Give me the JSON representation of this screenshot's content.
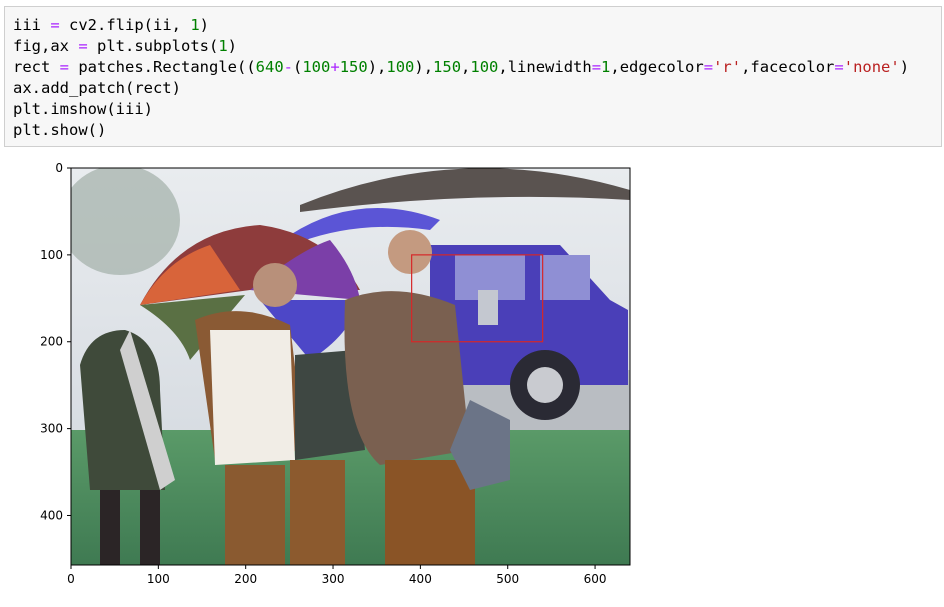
{
  "code_cell": {
    "lines": [
      "iii = cv2.flip(ii, 1)",
      "fig,ax = plt.subplots(1)",
      "rect = patches.Rectangle((640-(100+150),100),150,100,linewidth=1,edgecolor='r',facecolor='none')",
      "ax.add_patch(rect)",
      "plt.imshow(iii)",
      "plt.show()"
    ]
  },
  "plot": {
    "x_ticks": [
      "0",
      "100",
      "200",
      "300",
      "400",
      "500",
      "600"
    ],
    "y_ticks": [
      "0",
      "100",
      "200",
      "300",
      "400"
    ],
    "image_width": 640,
    "image_height": 457,
    "rectangle": {
      "x": 390,
      "y": 100,
      "width": 150,
      "height": 100,
      "edgecolor": "#d62728"
    },
    "image_description_colors": {
      "sky": "#dfe4ea",
      "grass": "#4f8a5d",
      "road": "#b9bdc2",
      "car": "#4a3fb8"
    }
  }
}
